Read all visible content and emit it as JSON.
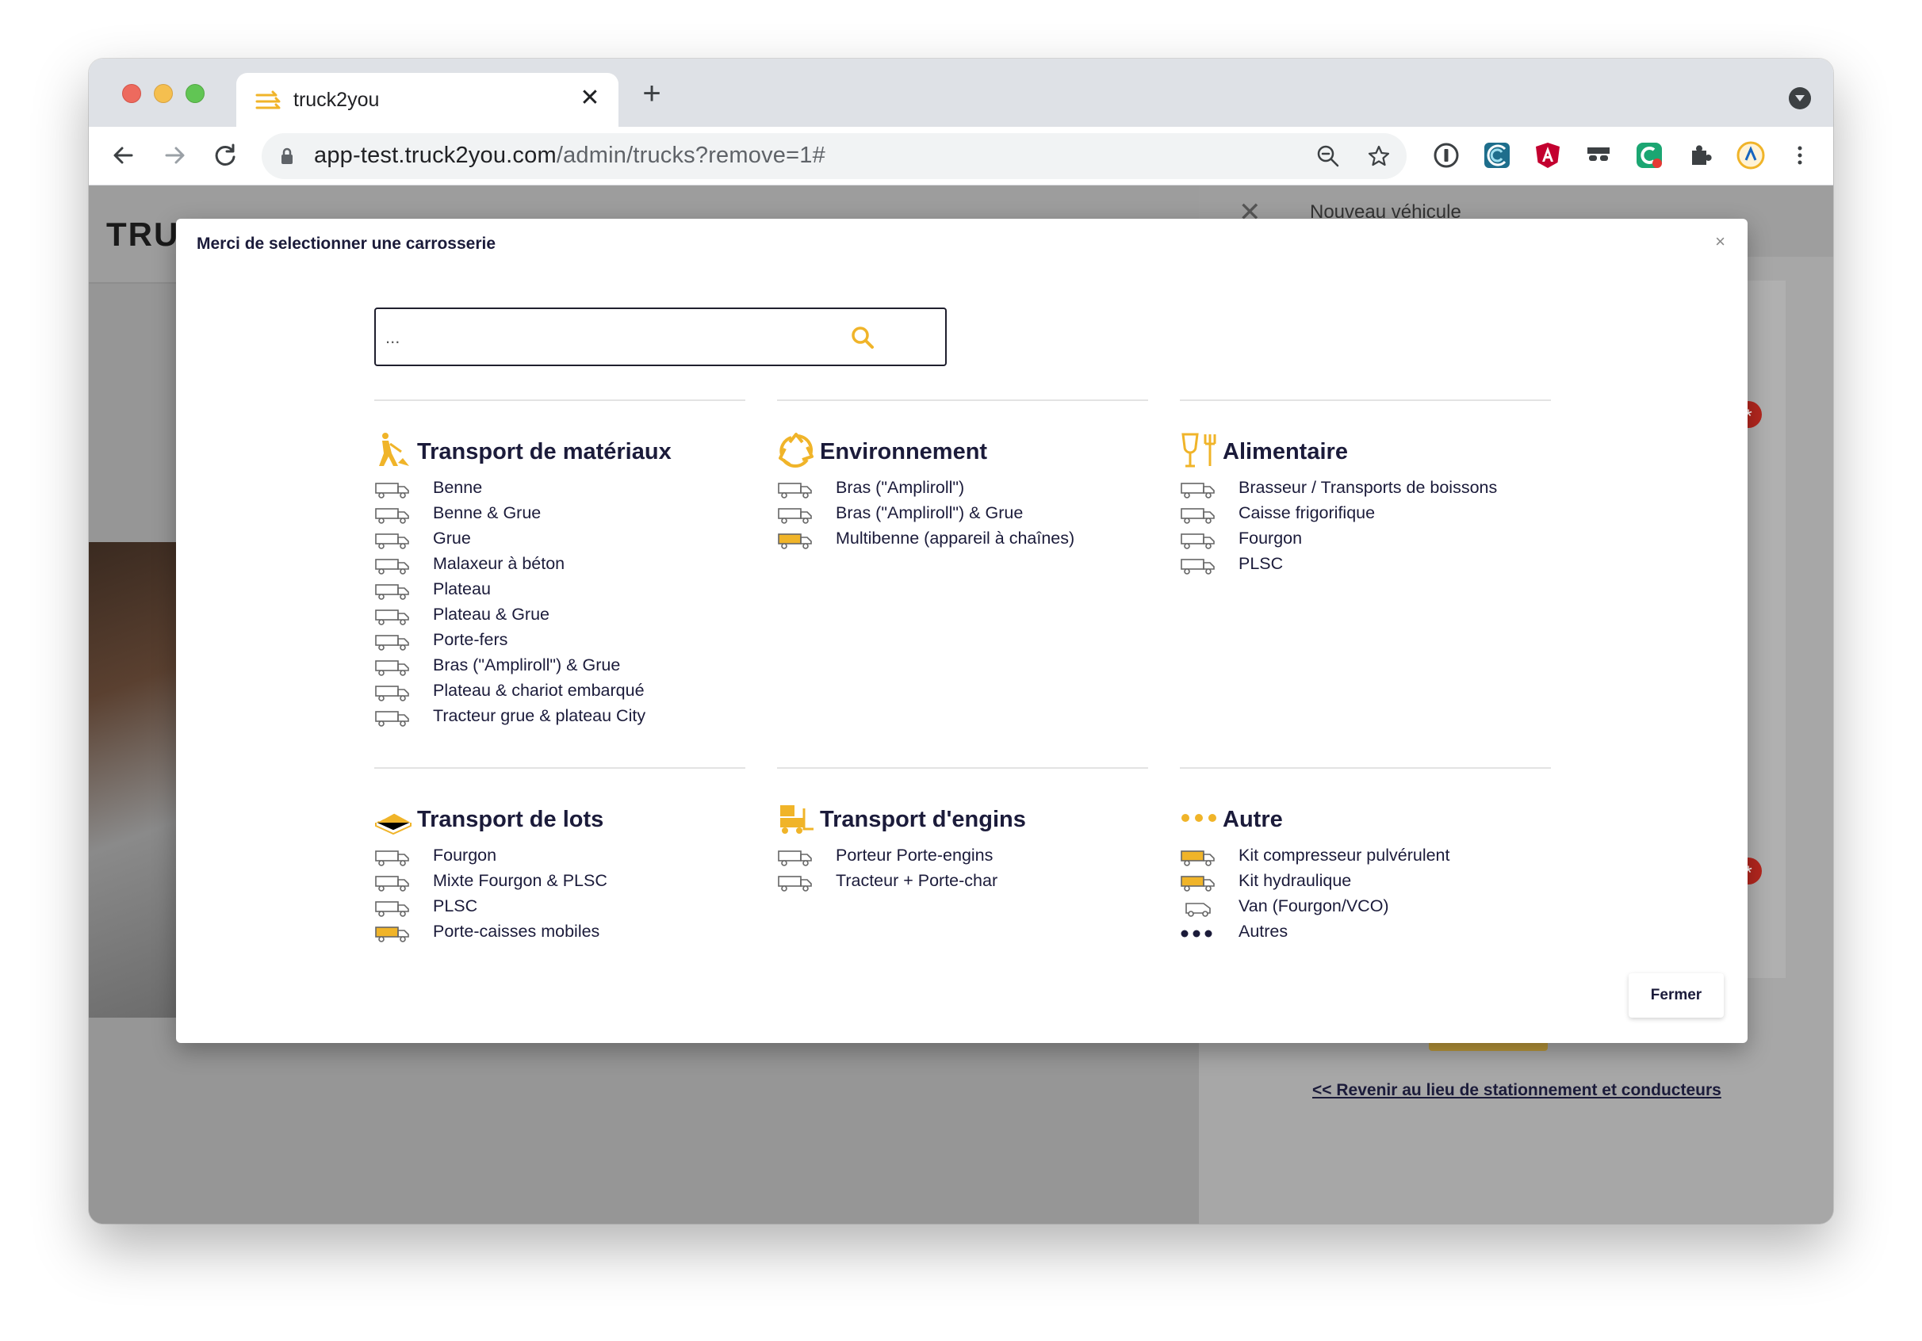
{
  "browser": {
    "tab_title": "truck2you",
    "url_domain": "app-test.truck2you.com",
    "url_path": "/admin/trucks?remove=1#"
  },
  "background": {
    "logo_partial": "TRU",
    "panel_title": "Nouveau véhicule",
    "back_link": "<< Revenir au lieu de stationnement et conducteurs"
  },
  "modal": {
    "title": "Merci de selectionner une carrosserie",
    "close": "×",
    "search_placeholder": "...",
    "close_button": "Fermer"
  },
  "categories": [
    {
      "title": "Transport de matériaux",
      "icon": "worker-icon",
      "items": [
        "Benne",
        "Benne & Grue",
        "Grue",
        "Malaxeur à béton",
        "Plateau",
        "Plateau & Grue",
        "Porte-fers",
        "Bras (\"Ampliroll\") & Grue",
        "Plateau & chariot embarqué",
        "Tracteur grue & plateau City"
      ]
    },
    {
      "title": "Environnement",
      "icon": "recycle-icon",
      "items": [
        "Bras (\"Ampliroll\")",
        "Bras (\"Ampliroll\") & Grue",
        "Multibenne (appareil à chaînes)"
      ]
    },
    {
      "title": "Alimentaire",
      "icon": "glass-fork-icon",
      "items": [
        "Brasseur / Transports de boissons",
        "Caisse frigorifique",
        "Fourgon",
        "PLSC"
      ]
    },
    {
      "title": "Transport de lots",
      "icon": "pallet-icon",
      "items": [
        "Fourgon",
        "Mixte Fourgon & PLSC",
        "PLSC",
        "Porte-caisses mobiles"
      ]
    },
    {
      "title": "Transport d'engins",
      "icon": "forklift-icon",
      "items": [
        "Porteur Porte-engins",
        "Tracteur + Porte-char"
      ]
    },
    {
      "title": "Autre",
      "icon": "dots-icon",
      "items": [
        "Kit compresseur pulvérulent",
        "Kit hydraulique",
        "Van (Fourgon/VCO)",
        "Autres"
      ]
    }
  ],
  "colors": {
    "accent": "#f0b429",
    "text": "#1b1b3a",
    "overlay": "#8a8a8a"
  }
}
